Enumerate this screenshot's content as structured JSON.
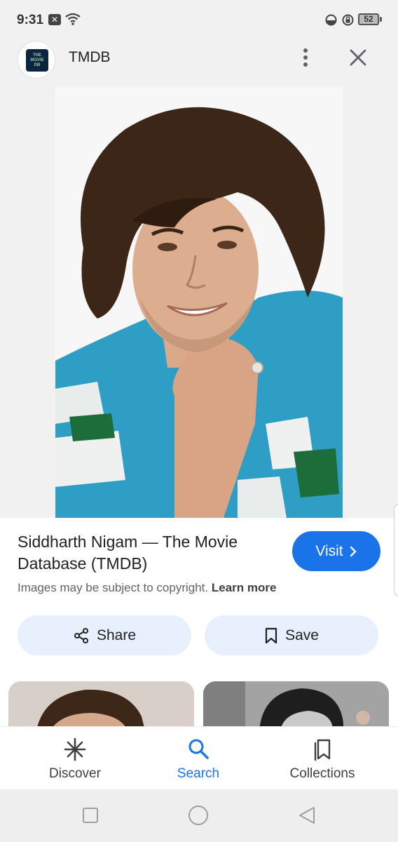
{
  "status_bar": {
    "time": "9:31",
    "notification_icon": "x-notification-icon",
    "battery_level": "52"
  },
  "app_bar": {
    "title": "TMDB",
    "logo_text": [
      "THE",
      "MOVIE",
      "DB"
    ]
  },
  "result": {
    "title": "Siddharth Nigam — The Movie Database (TMDB)",
    "visit_label": "Visit",
    "copyright_text": "Images may be subject to copyright.",
    "learn_more_label": "Learn more"
  },
  "actions": {
    "share_label": "Share",
    "save_label": "Save"
  },
  "bottom_nav": {
    "items": [
      {
        "label": "Discover",
        "icon": "asterisk-icon"
      },
      {
        "label": "Search",
        "icon": "search-icon",
        "active": true
      },
      {
        "label": "Collections",
        "icon": "collections-icon"
      }
    ]
  },
  "colors": {
    "accent": "#1a73e8",
    "chip_bg": "#e8f0fe",
    "app_bar_bg": "#f1f1f1"
  }
}
